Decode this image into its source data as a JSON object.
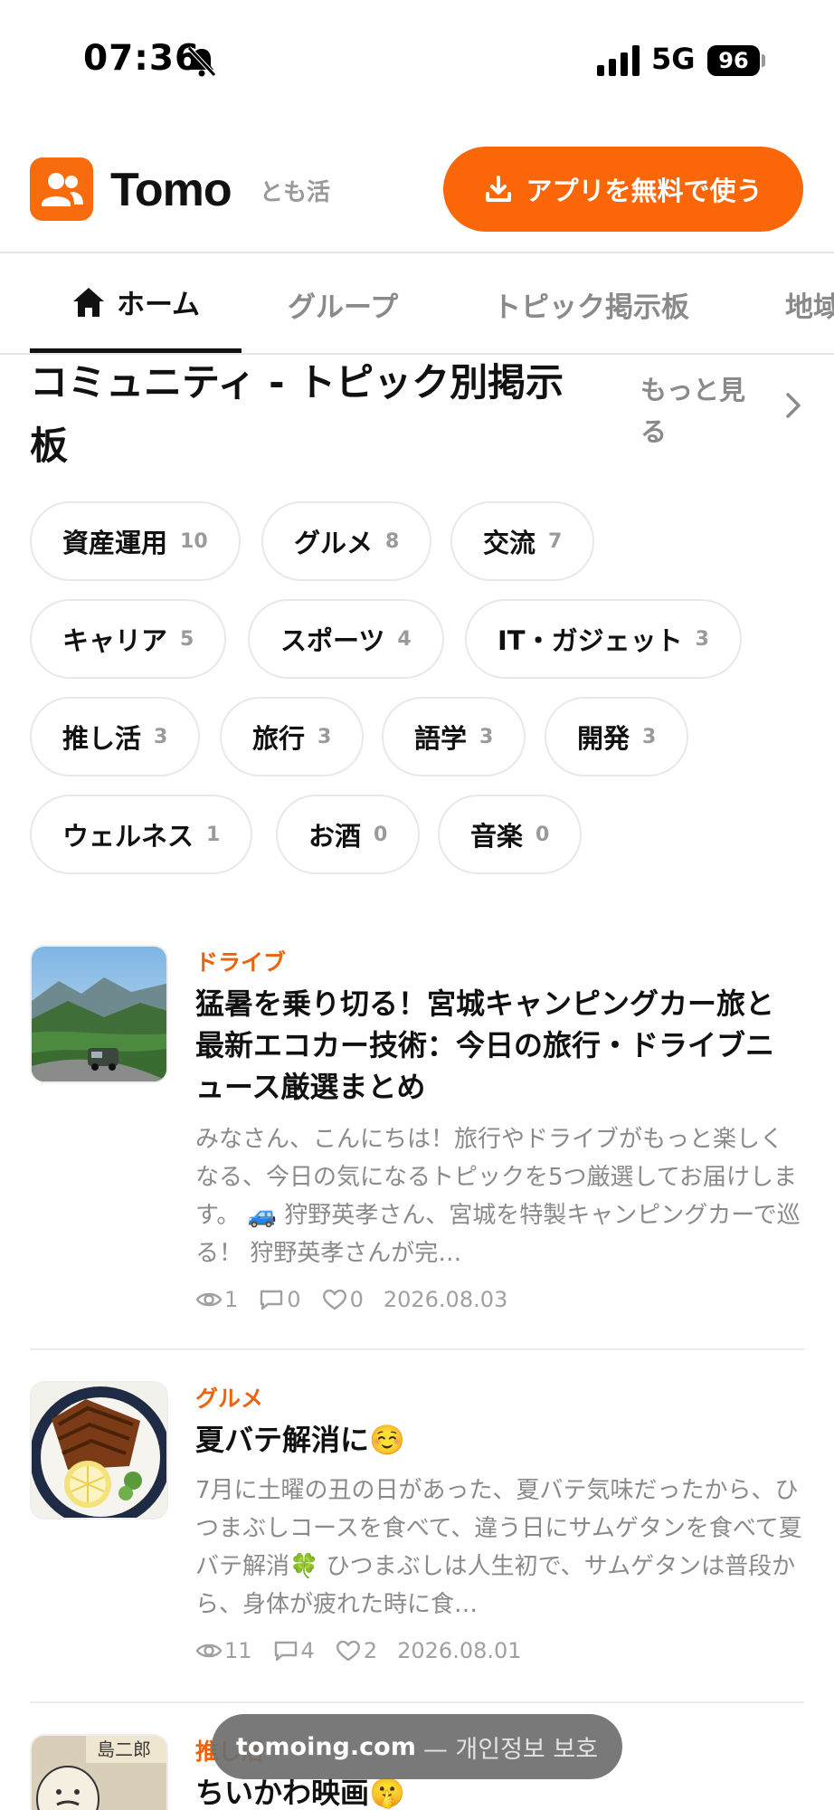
{
  "status": {
    "time": "07:36",
    "network": "5G",
    "battery": "96"
  },
  "header": {
    "brand": "Tomo",
    "brand_sub": "とも活",
    "cta_label": "アプリを無料で使う",
    "accent_color": "#fb6609"
  },
  "tabs": [
    {
      "label": "ホーム",
      "active": true
    },
    {
      "label": "グループ"
    },
    {
      "label": "トピック掲示板"
    },
    {
      "label": "地域"
    }
  ],
  "section": {
    "title": "コミュニティ - トピック別掲示板",
    "more_label": "もっと見る"
  },
  "categories": [
    {
      "label": "資産運用",
      "count": "10"
    },
    {
      "label": "グルメ",
      "count": "8"
    },
    {
      "label": "交流",
      "count": "7"
    },
    {
      "label": "キャリア",
      "count": "5"
    },
    {
      "label": "スポーツ",
      "count": "4"
    },
    {
      "label": "IT・ガジェット",
      "count": "3"
    },
    {
      "label": "推し活",
      "count": "3"
    },
    {
      "label": "旅行",
      "count": "3"
    },
    {
      "label": "語学",
      "count": "3"
    },
    {
      "label": "開発",
      "count": "3"
    },
    {
      "label": "ウェルネス",
      "count": "1"
    },
    {
      "label": "お酒",
      "count": "0"
    },
    {
      "label": "音楽",
      "count": "0"
    }
  ],
  "posts": [
    {
      "category": "ドライブ",
      "title": "猛暑を乗り切る！宮城キャンピングカー旅と最新エコカー技術：今日の旅行・ドライブニュース厳選まとめ",
      "excerpt": "みなさん、こんにちは！旅行やドライブがもっと楽しくなる、今日の気になるトピックを5つ厳選してお届けします。 🚙 狩野英孝さん、宮城を特製キャンピングカーで巡る！ 狩野英孝さんが完…",
      "views": "1",
      "comments": "0",
      "likes": "0",
      "date": "2026.08.03"
    },
    {
      "category": "グルメ",
      "title": "夏バテ解消に☺️",
      "excerpt": "7月に土曜の丑の日があった、夏バテ気味だったから、ひつまぶしコースを食べて、違う日にサムゲタンを食べて夏バテ解消🍀 ひつまぶしは人生初で、サムゲタンは普段から、身体が疲れた時に食…",
      "views": "11",
      "comments": "4",
      "likes": "2",
      "date": "2026.08.01"
    },
    {
      "category": "推し活",
      "title": "ちいかわ映画🤫",
      "thumb_text": "島二郎"
    }
  ],
  "toast": {
    "domain": "tomoing.com",
    "note": "— 개인정보 보호"
  }
}
